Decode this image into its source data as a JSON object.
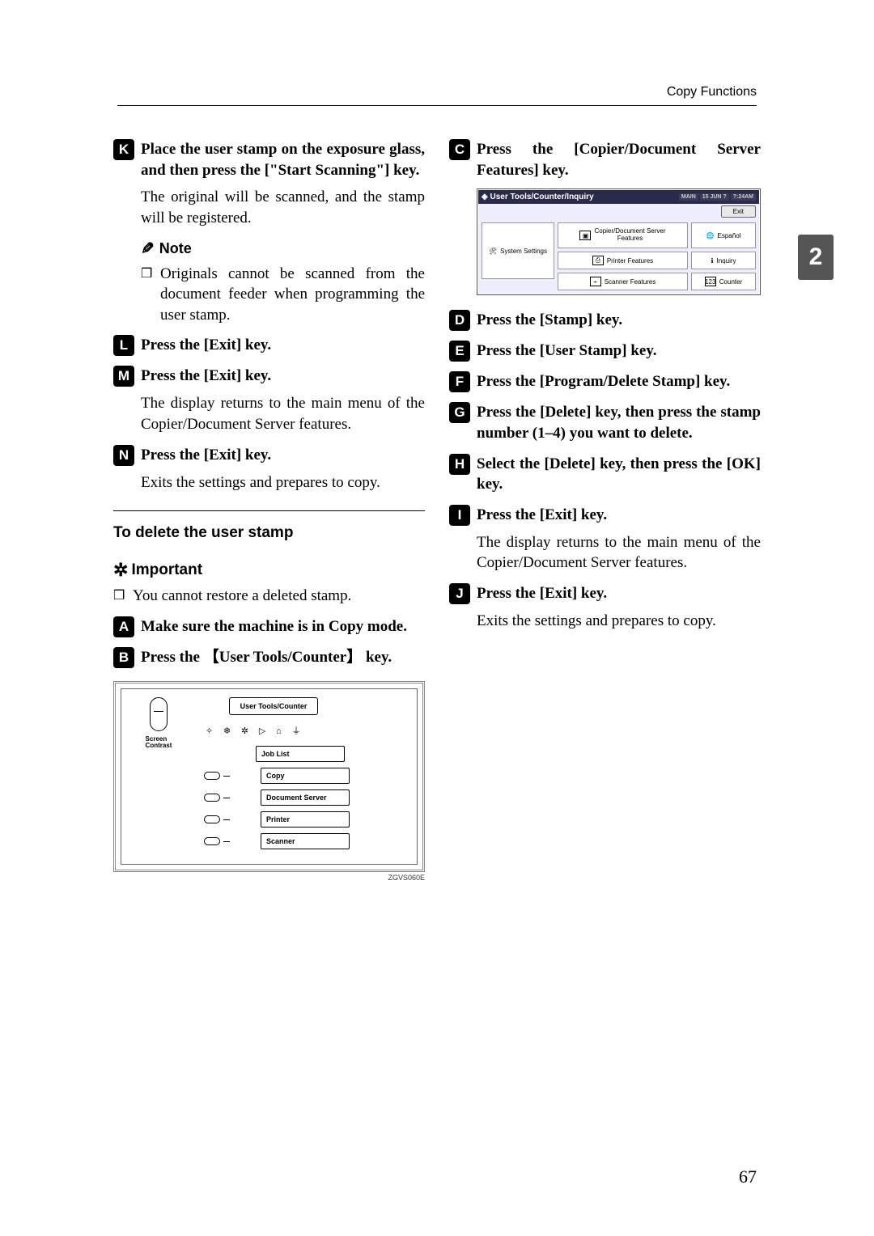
{
  "header": {
    "right": "Copy Functions"
  },
  "side_tab": "2",
  "page_number": "67",
  "left": {
    "step11": "Place the user stamp on the exposure glass, and then press the [\"Start Scanning\"] key.",
    "step11_body": "The original will be scanned, and the stamp will be registered.",
    "note_label": "Note",
    "note_bullet": "Originals cannot be scanned from the document feeder when programming the user stamp.",
    "step12": "Press the [Exit] key.",
    "step13": "Press the [Exit] key.",
    "step13_body": "The display returns to the main menu of the Copier/Document Server features.",
    "step14": "Press the [Exit] key.",
    "step14_body": "Exits the settings and prepares to copy.",
    "section_heading": "To delete the user stamp",
    "important_label": "Important",
    "important_bullet": "You cannot restore a deleted stamp.",
    "step1": "Make sure the machine is in Copy mode.",
    "step2": "Press the 【User Tools/Counter】 key.",
    "fig1": {
      "top_btn": "User Tools/Counter",
      "screen_contrast": "Screen\nContrast",
      "btns": [
        "Job List",
        "Copy",
        "Document Server",
        "Printer",
        "Scanner"
      ],
      "code": "ZGVS060E"
    }
  },
  "right": {
    "step3": "Press the [Copier/Document Server Features] key.",
    "fig2": {
      "title": "User Tools/Counter/Inquiry",
      "bar_tabs": [
        "MAIN",
        "15 JUN ?",
        "?:24AM"
      ],
      "exit": "Exit",
      "system_settings": "System Settings",
      "mid": [
        "Copier/Document Server\nFeatures",
        "Printer Features",
        "Scanner Features"
      ],
      "rightc": [
        "Español",
        "Inquiry",
        "Counter"
      ]
    },
    "step4": "Press the [Stamp] key.",
    "step5": "Press the [User Stamp] key.",
    "step6": "Press the [Program/Delete Stamp] key.",
    "step7": "Press the [Delete] key, then press the stamp number (1–4) you want to delete.",
    "step8": "Select the [Delete] key, then press the [OK] key.",
    "step9": "Press the [Exit] key.",
    "step9_body": "The display returns to the main menu of the Copier/Document Server features.",
    "step10": "Press the [Exit] key.",
    "step10_body": "Exits the settings and prepares to copy."
  }
}
